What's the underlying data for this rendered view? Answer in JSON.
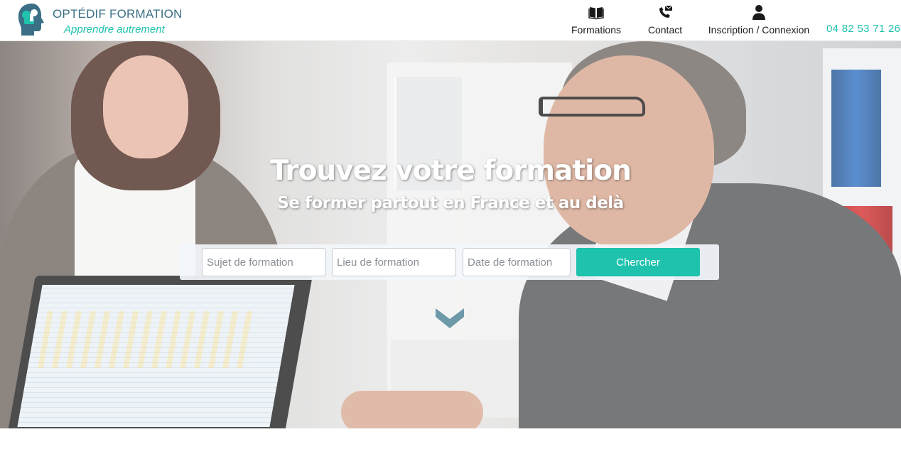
{
  "brand": {
    "name": "OPTÉDIF FORMATION",
    "tagline": "Apprendre autrement",
    "logo_icon": "head-puzzle-logo",
    "colors": {
      "primary": "#1fc2ad",
      "secondary": "#3a6f85"
    }
  },
  "nav": {
    "items": [
      {
        "label": "Formations",
        "icon": "book-icon"
      },
      {
        "label": "Contact",
        "icon": "phone-mail-icon"
      },
      {
        "label": "Inscription / Connexion",
        "icon": "user-icon"
      }
    ],
    "phone": "04 82 53 71 26"
  },
  "hero": {
    "title": "Trouvez votre formation",
    "subtitle": "Se former partout en France et au delà",
    "background": "photo-office-meeting"
  },
  "search": {
    "subject_placeholder": "Sujet de formation",
    "place_placeholder": "Lieu de formation",
    "date_placeholder": "Date de formation",
    "button_label": "Chercher"
  },
  "scroll_icon": "chevron-down-icon"
}
